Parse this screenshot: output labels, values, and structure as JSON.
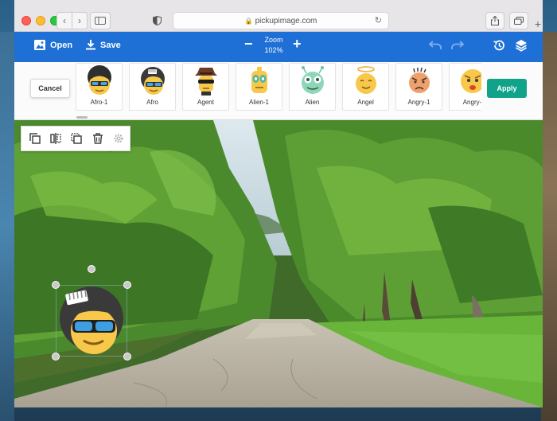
{
  "browser": {
    "url": "pickupimage.com"
  },
  "toolbar": {
    "open_label": "Open",
    "save_label": "Save",
    "zoom_label": "Zoom",
    "zoom_value": "102%",
    "zoom_minus": "−",
    "zoom_plus": "+"
  },
  "strip": {
    "cancel_label": "Cancel",
    "apply_label": "Apply",
    "stickers": [
      {
        "label": "Afro-1",
        "icon": "afro-1-sticker-icon"
      },
      {
        "label": "Afro",
        "icon": "afro-sticker-icon"
      },
      {
        "label": "Agent",
        "icon": "agent-sticker-icon"
      },
      {
        "label": "Alien-1",
        "icon": "alien-1-sticker-icon"
      },
      {
        "label": "Alien",
        "icon": "alien-sticker-icon"
      },
      {
        "label": "Angel",
        "icon": "angel-sticker-icon"
      },
      {
        "label": "Angry-1",
        "icon": "angry-1-sticker-icon"
      },
      {
        "label": "Angry-",
        "icon": "angry-sticker-icon"
      }
    ]
  },
  "canvas_tools": [
    "duplicate-icon",
    "flip-icon",
    "bring-front-icon",
    "trash-icon",
    "settings-icon"
  ],
  "colors": {
    "topbar": "#1e6fd6",
    "apply": "#11a389",
    "face": "#f7c84a",
    "hair": "#3a3a3a"
  }
}
